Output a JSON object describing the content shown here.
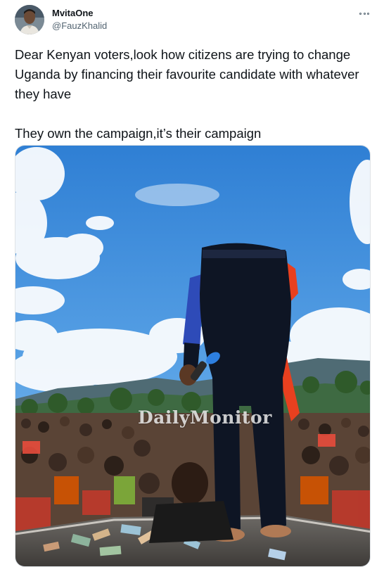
{
  "tweet": {
    "display_name": "MvitaOne",
    "handle": "@FauzKhalid",
    "more_icon": "more-horizontal-icon",
    "text": "Dear Kenyan voters,look how citizens are trying to change Uganda by financing their favourite candidate with whatever they have\n\nThey own the campaign,it’s their campaign",
    "media": {
      "watermark": "DailyMonitor"
    }
  },
  "colors": {
    "text": "#0f1419",
    "secondary": "#536471",
    "sky": "#3f8fd8"
  }
}
